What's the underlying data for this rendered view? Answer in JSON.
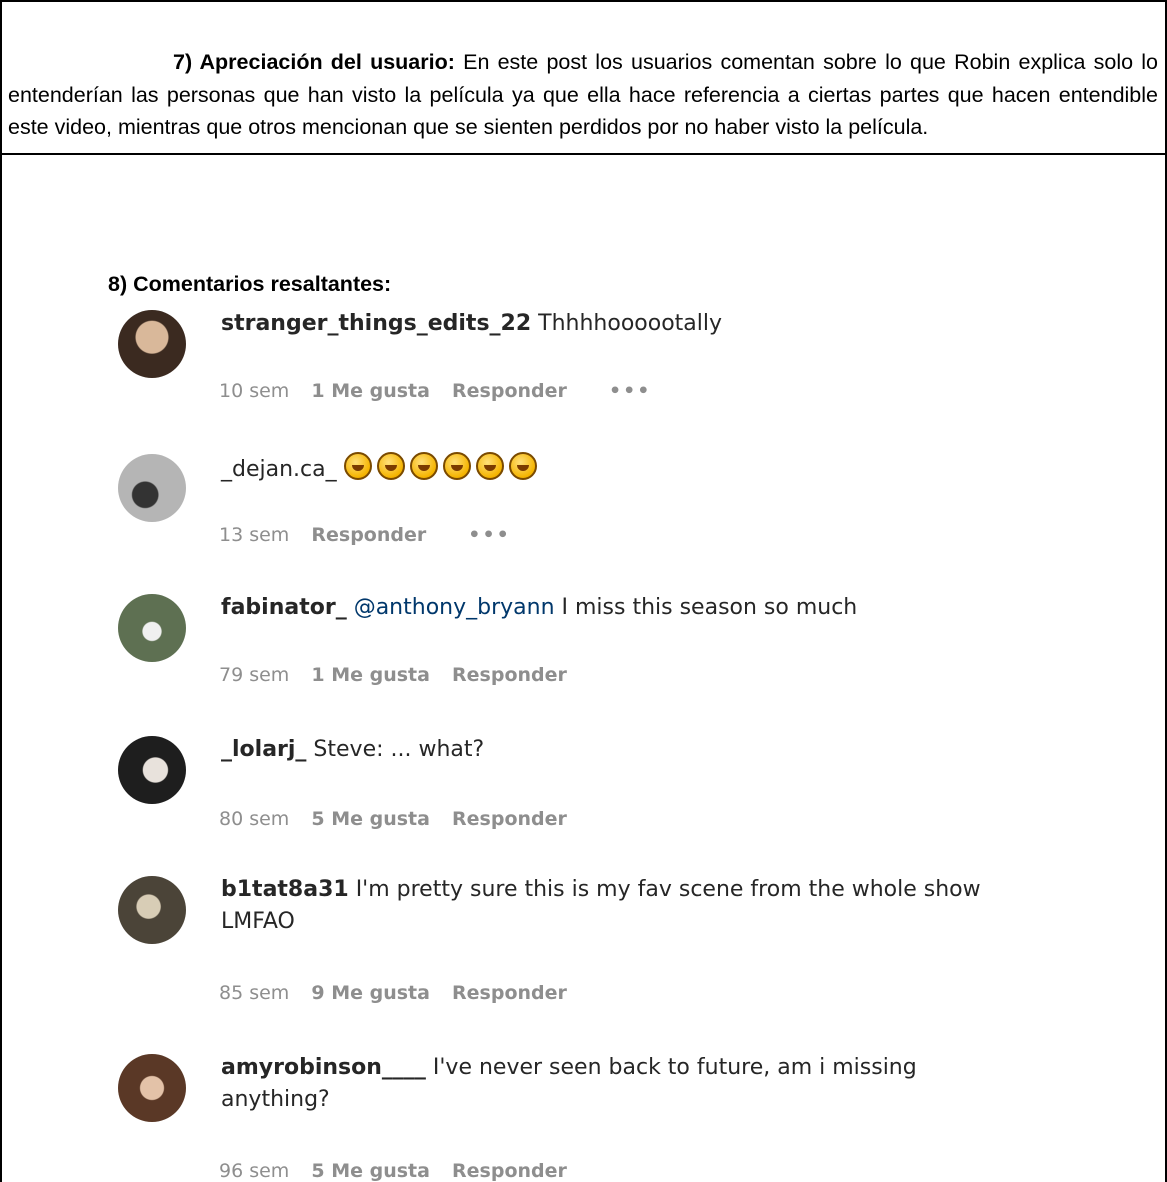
{
  "section7": {
    "heading": "7) Apreciación del usuario:",
    "text": " En este post los usuarios comentan sobre lo que Robin explica solo lo entenderían las personas que han visto la película ya que ella hace referencia a ciertas partes que hacen entendible este video, mientras que otros mencionan que se sienten perdidos por no haber visto la película."
  },
  "section8": {
    "heading": "8) Comentarios resaltantes:"
  },
  "comments": [
    {
      "user": "stranger_things_edits_22",
      "mention": "",
      "text": " Thhhhoooootally",
      "time": "10 sem",
      "likes": "1 Me gusta",
      "reply": "Responder",
      "more": "•••",
      "avatar_color": "#5a4a3e"
    },
    {
      "user": "_dejan.ca_",
      "mention": "",
      "text": " ",
      "emoji_icons": [
        "rofl-emoji",
        "rofl-emoji",
        "rofl-emoji",
        "rofl-emoji",
        "rofl-emoji",
        "rofl-emoji"
      ],
      "time": "13 sem",
      "likes": "",
      "reply": "Responder",
      "more": "•••",
      "avatar_color": "#9e9e9e"
    },
    {
      "user": "fabinator_",
      "mention": " @anthony_bryann",
      "text": " I miss this season so much",
      "time": "79 sem",
      "likes": "1 Me gusta",
      "reply": "Responder",
      "more": "",
      "avatar_color": "#6d7b63"
    },
    {
      "user": "_lolarj_",
      "mention": "",
      "text": " Steve: ... what?",
      "time": "80 sem",
      "likes": "5 Me gusta",
      "reply": "Responder",
      "more": "",
      "avatar_color": "#3a3a3a"
    },
    {
      "user": "b1tat8a31",
      "mention": "",
      "text": " I'm pretty sure this is my fav scene from the whole show LMFAO",
      "time": "85 sem",
      "likes": "9 Me gusta",
      "reply": "Responder",
      "more": "",
      "avatar_color": "#7c7262"
    },
    {
      "user": "amyrobinson____",
      "mention": "",
      "text": " I've never seen back to future, am i missing anything?",
      "time": "96 sem",
      "likes": "5 Me gusta",
      "reply": "Responder",
      "more": "",
      "avatar_color": "#6b4a36"
    }
  ]
}
